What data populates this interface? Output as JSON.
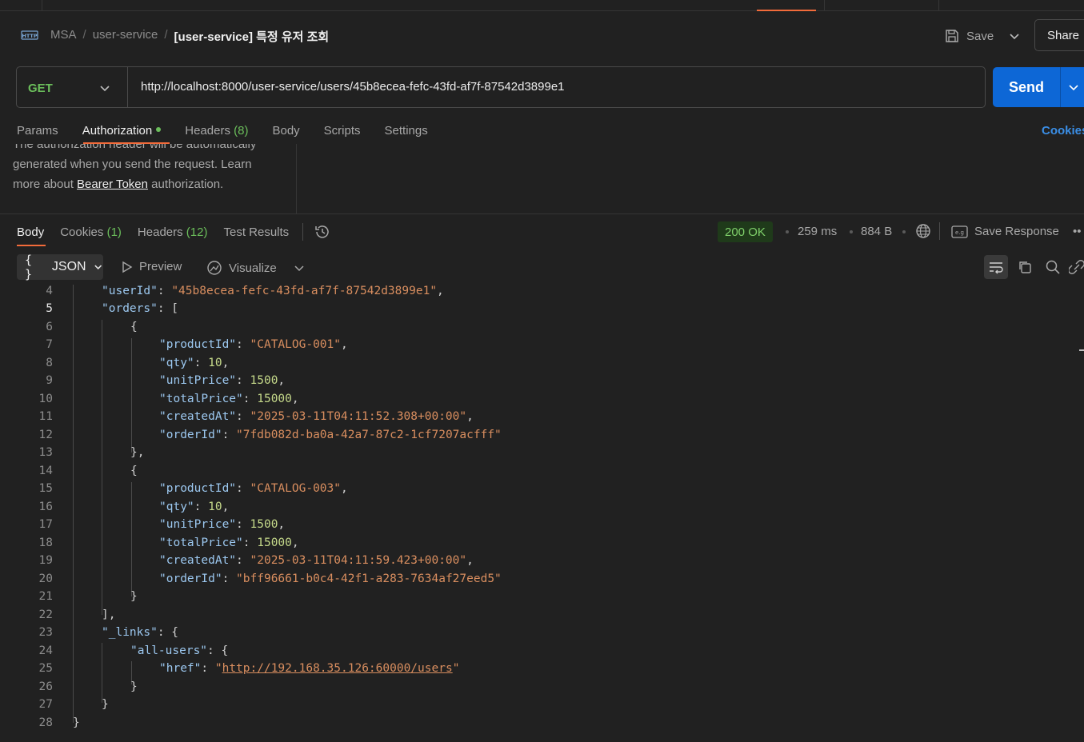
{
  "breadcrumb": {
    "workspace": "MSA",
    "collection": "user-service",
    "request": "[user-service] 특정 유저 조회"
  },
  "header": {
    "save_label": "Save",
    "share_label": "Share"
  },
  "request": {
    "method": "GET",
    "url": "http://localhost:8000/user-service/users/45b8ecea-fefc-43fd-af7f-87542d3899e1",
    "send_label": "Send"
  },
  "request_tabs": {
    "params": "Params",
    "authorization": "Authorization",
    "headers": "Headers",
    "headers_count": "(8)",
    "body": "Body",
    "scripts": "Scripts",
    "settings": "Settings",
    "cookies": "Cookies"
  },
  "auth": {
    "line0": "The authorization header will be automatically",
    "line1": "generated when you send the request. Learn",
    "line2_pre": "more about ",
    "link": "Bearer Token",
    "line2_post": " authorization."
  },
  "response_tabs": {
    "body": "Body",
    "cookies": "Cookies",
    "cookies_count": "(1)",
    "headers": "Headers",
    "headers_count": "(12)",
    "test_results": "Test Results"
  },
  "response_meta": {
    "status": "200 OK",
    "time": "259 ms",
    "size": "884 B",
    "save_response": "Save Response"
  },
  "toolbar": {
    "format": "JSON",
    "preview": "Preview",
    "visualize": "Visualize"
  },
  "code": {
    "l4_key": "\"userId\"",
    "l4_val": "\"45b8ecea-fefc-43fd-af7f-87542d3899e1\"",
    "l5_key": "\"orders\"",
    "o1_productId": "\"CATALOG-001\"",
    "o1_qty": "10",
    "o1_unitPrice": "1500",
    "o1_totalPrice": "15000",
    "o1_createdAt": "\"2025-03-11T04:11:52.308+00:00\"",
    "o1_orderId": "\"7fdb082d-ba0a-42a7-87c2-1cf7207acfff\"",
    "o2_productId": "\"CATALOG-003\"",
    "o2_qty": "10",
    "o2_unitPrice": "1500",
    "o2_totalPrice": "15000",
    "o2_createdAt": "\"2025-03-11T04:11:59.423+00:00\"",
    "o2_orderId": "\"bff96661-b0c4-42f1-a283-7634af27eed5\"",
    "k_productId": "\"productId\"",
    "k_qty": "\"qty\"",
    "k_unitPrice": "\"unitPrice\"",
    "k_totalPrice": "\"totalPrice\"",
    "k_createdAt": "\"createdAt\"",
    "k_orderId": "\"orderId\"",
    "k_links": "\"_links\"",
    "k_allusers": "\"all-users\"",
    "k_href": "\"href\"",
    "href_url": "http://192.168.35.126:60000/users",
    "ln4": "4",
    "ln5": "5",
    "ln6": "6",
    "ln7": "7",
    "ln8": "8",
    "ln9": "9",
    "ln10": "10",
    "ln11": "11",
    "ln12": "12",
    "ln13": "13",
    "ln14": "14",
    "ln15": "15",
    "ln16": "16",
    "ln17": "17",
    "ln18": "18",
    "ln19": "19",
    "ln20": "20",
    "ln21": "21",
    "ln22": "22",
    "ln23": "23",
    "ln24": "24",
    "ln25": "25",
    "ln26": "26",
    "ln27": "27",
    "ln28": "28"
  }
}
